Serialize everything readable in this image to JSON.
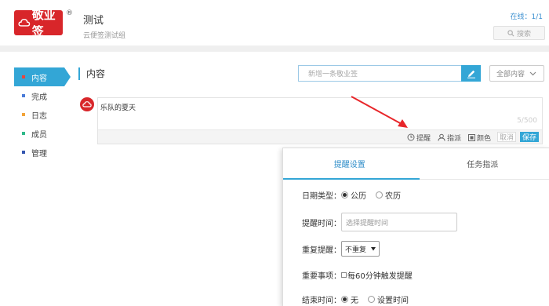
{
  "header": {
    "logo_text": "敬业签",
    "logo_reg": "®",
    "title": "测试",
    "subtitle": "云便签测试组",
    "online": "在线：1/1",
    "search_label": "搜索",
    "brand_color": "#d8262a"
  },
  "sidebar": {
    "items": [
      {
        "label": "内容",
        "color": "#e8453c"
      },
      {
        "label": "完成",
        "color": "#4a7bd8"
      },
      {
        "label": "日志",
        "color": "#f2a43a"
      },
      {
        "label": "成员",
        "color": "#2fb98a"
      },
      {
        "label": "管理",
        "color": "#3456b0"
      }
    ]
  },
  "main": {
    "section_title": "内容",
    "new_placeholder": "新增一条敬业签",
    "filter_label": "全部内容",
    "accent": "#33a6d6"
  },
  "note": {
    "text": "乐队的夏天",
    "counter": "5/500",
    "tools": {
      "remind": "提醒",
      "assign": "指派",
      "color": "颜色",
      "cancel": "取消",
      "save": "保存"
    }
  },
  "popup": {
    "tabs": [
      "提醒设置",
      "任务指派"
    ],
    "date_type_label": "日期类型：",
    "date_type_options": [
      "公历",
      "农历"
    ],
    "remind_time_label": "提醒时间：",
    "remind_time_placeholder": "选择提醒时间",
    "repeat_label": "重复提醒：",
    "repeat_value": "不重复",
    "important_label": "重要事项：",
    "important_option": "每60分钟触发提醒",
    "end_time_label": "结束时间：",
    "end_time_options": [
      "无",
      "设置时间"
    ]
  }
}
